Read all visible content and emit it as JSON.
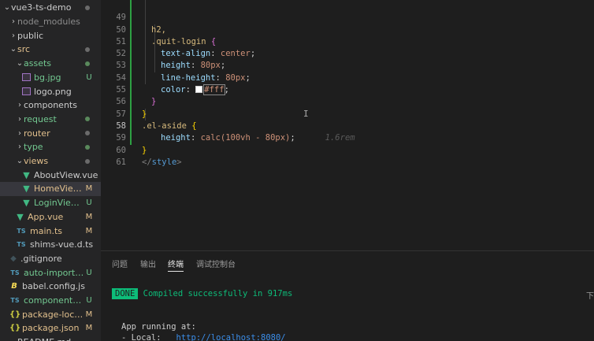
{
  "sidebar": {
    "items": [
      {
        "label": "vue3-ts-demo",
        "chevron": "⌄",
        "icon": "",
        "status": "dot",
        "style": "root"
      },
      {
        "label": "node_modules",
        "chevron": "›",
        "icon": "",
        "status": "",
        "style": "dim"
      },
      {
        "label": "public",
        "chevron": "›",
        "icon": "",
        "status": "",
        "style": ""
      },
      {
        "label": "src",
        "chevron": "⌄",
        "icon": "",
        "status": "dot",
        "style": "mod"
      },
      {
        "label": "assets",
        "chevron": "⌄",
        "icon": "",
        "status": "dot-green",
        "style": "new"
      },
      {
        "label": "bg.jpg",
        "chevron": "",
        "icon": "img",
        "status": "U",
        "style": "new"
      },
      {
        "label": "logo.png",
        "chevron": "",
        "icon": "img",
        "status": "",
        "style": ""
      },
      {
        "label": "components",
        "chevron": "›",
        "icon": "",
        "status": "",
        "style": ""
      },
      {
        "label": "request",
        "chevron": "›",
        "icon": "",
        "status": "dot-green",
        "style": "new"
      },
      {
        "label": "router",
        "chevron": "›",
        "icon": "",
        "status": "dot",
        "style": "mod"
      },
      {
        "label": "type",
        "chevron": "›",
        "icon": "",
        "status": "dot-green",
        "style": "new"
      },
      {
        "label": "views",
        "chevron": "⌄",
        "icon": "",
        "status": "dot",
        "style": "mod"
      },
      {
        "label": "AboutView.vue",
        "chevron": "",
        "icon": "vue",
        "status": "",
        "style": ""
      },
      {
        "label": "HomeView....",
        "chevron": "",
        "icon": "vue",
        "status": "M",
        "style": "mod",
        "selected": true
      },
      {
        "label": "LoginView.vue",
        "chevron": "",
        "icon": "vue",
        "status": "U",
        "style": "new"
      },
      {
        "label": "App.vue",
        "chevron": "",
        "icon": "vue",
        "status": "M",
        "style": "mod"
      },
      {
        "label": "main.ts",
        "chevron": "",
        "icon": "ts",
        "status": "M",
        "style": "mod"
      },
      {
        "label": "shims-vue.d.ts",
        "chevron": "",
        "icon": "ts",
        "status": "",
        "style": ""
      },
      {
        "label": ".gitignore",
        "chevron": "",
        "icon": "git",
        "status": "",
        "style": ""
      },
      {
        "label": "auto-imports.d.ts",
        "chevron": "",
        "icon": "ts",
        "status": "U",
        "style": "new"
      },
      {
        "label": "babel.config.js",
        "chevron": "",
        "icon": "babel",
        "status": "",
        "style": ""
      },
      {
        "label": "components.d.ts",
        "chevron": "",
        "icon": "ts",
        "status": "U",
        "style": "new"
      },
      {
        "label": "package-lock.j...",
        "chevron": "",
        "icon": "json",
        "status": "M",
        "style": "mod"
      },
      {
        "label": "package.json",
        "chevron": "",
        "icon": "json",
        "status": "M",
        "style": "mod"
      },
      {
        "label": "README.md",
        "chevron": "",
        "icon": "",
        "status": "",
        "style": ""
      }
    ]
  },
  "editor": {
    "lines": [
      {
        "num": "49",
        "html_key": "l49"
      },
      {
        "num": "50",
        "html_key": "l50"
      },
      {
        "num": "51",
        "html_key": "l51"
      },
      {
        "num": "52",
        "html_key": "l52"
      },
      {
        "num": "53",
        "html_key": "l53"
      },
      {
        "num": "54",
        "html_key": "l54"
      },
      {
        "num": "55",
        "html_key": "l55"
      },
      {
        "num": "56",
        "html_key": "l56"
      },
      {
        "num": "57",
        "html_key": "l57"
      },
      {
        "num": "58",
        "html_key": "l58",
        "active": true
      },
      {
        "num": "59",
        "html_key": "l59"
      },
      {
        "num": "60",
        "html_key": "l60"
      },
      {
        "num": "61",
        "html_key": "l61"
      }
    ],
    "code": {
      "l49": "h2,",
      "l50_sel": ".quit-login",
      "l50_brace": "{",
      "l51_prop": "text-align",
      "l51_val": "center",
      "l52_prop": "height",
      "l52_val": "80px",
      "l53_prop": "line-height",
      "l53_val": "80px",
      "l54_prop": "color",
      "l54_val": "#fff",
      "l55": "}",
      "l56": "}",
      "l57_sel": ".el-aside",
      "l57_brace": "{",
      "l58_prop": "height",
      "l58_val": "calc(100vh - 80px)",
      "l58_hint": "1.6rem",
      "l59": "}",
      "l60_open": "</",
      "l60_name": "style",
      "l60_close": ">"
    }
  },
  "panel": {
    "tabs": [
      {
        "label": "问题"
      },
      {
        "label": "输出"
      },
      {
        "label": "终端",
        "active": true
      },
      {
        "label": "调试控制台"
      }
    ],
    "terminal": {
      "done_label": "DONE",
      "compiled": "Compiled successfully in 917ms",
      "app_running": "App running at:",
      "local_label": "- Local:   ",
      "local_url": "http://localhost:8080/",
      "side_char": "下"
    }
  },
  "colors": {
    "accent_green": "#0dbc79",
    "modified": "#e2c08d",
    "untracked": "#73c991",
    "link": "#3b8eea"
  }
}
